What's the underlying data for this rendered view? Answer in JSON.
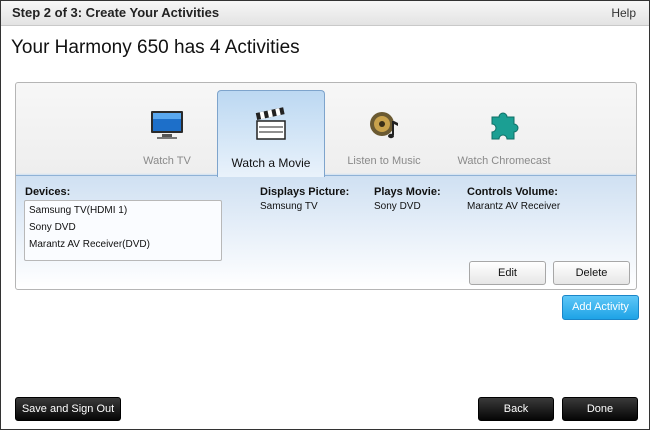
{
  "header": {
    "step_title": "Step 2 of 3: Create Your Activities",
    "help": "Help"
  },
  "page_title": "Your Harmony 650 has 4 Activities",
  "tabs": [
    {
      "label": "Watch TV",
      "icon": "tv-icon",
      "active": false
    },
    {
      "label": "Watch a Movie",
      "icon": "clapperboard-icon",
      "active": true
    },
    {
      "label": "Listen to Music",
      "icon": "speaker-music-icon",
      "active": false
    },
    {
      "label": "Watch Chromecast",
      "icon": "puzzle-piece-icon",
      "active": false
    }
  ],
  "details": {
    "devices_label": "Devices:",
    "devices": [
      "Samsung TV(HDMI 1)",
      "Sony DVD",
      "Marantz AV Receiver(DVD)"
    ],
    "displays_picture": {
      "label": "Displays Picture:",
      "value": "Samsung TV"
    },
    "plays_movie": {
      "label": "Plays Movie:",
      "value": "Sony DVD"
    },
    "controls_volume": {
      "label": "Controls Volume:",
      "value": "Marantz AV Receiver"
    }
  },
  "buttons": {
    "edit": "Edit",
    "delete": "Delete",
    "add_activity": "Add Activity",
    "save_sign_out": "Save and Sign Out",
    "back": "Back",
    "done": "Done"
  },
  "colors": {
    "accent_blue": "#1ea3e6",
    "dark_button": "#111111",
    "active_tab": "#bcd8f2"
  }
}
